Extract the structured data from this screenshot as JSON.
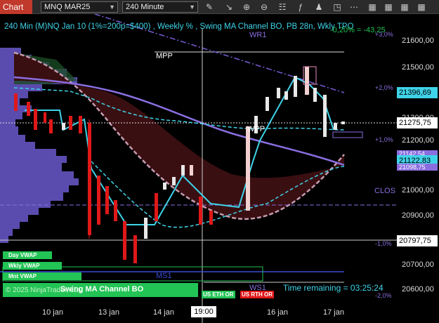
{
  "toolbar": {
    "tab_label": "Chart",
    "instrument": "MNQ MAR25",
    "interval": "240 Minute",
    "icons": [
      "draw-pencil-icon",
      "zoom-in-icon",
      "zoom-out-icon",
      "properties-icon",
      "indicators-icon",
      "strategy-icon",
      "screenshot-icon",
      "more-icon",
      "grid-icon-1",
      "grid-icon-2",
      "grid-icon-3",
      "grid-icon-4"
    ]
  },
  "chart": {
    "header": "240 Min (M)NQ Jan 10 (1%=200p=$400) , Weekly % , Swing MA Channel BO, PB 28n, Wkly TPO",
    "change_label": "-0,20% = -43,25",
    "labels": {
      "wr1": "WR1",
      "mpp": "MPP",
      "wpp": "WPP",
      "clos": "CLOS",
      "ms1": "MS1",
      "ws1": "WS1"
    },
    "pct_labels": [
      "+3,0%",
      "+2,0%",
      "+1,0%",
      "-1,0%",
      "-2,0%"
    ],
    "price_axis": [
      "21600,00",
      "21500,00",
      "21300,00",
      "21200,00",
      "21000,00",
      "20900,00",
      "20700,00",
      "20600,00"
    ],
    "price_tags": {
      "p1": "21396,69",
      "p2": "21275,75",
      "p3": "21122,83",
      "p4": "21098,75",
      "p5": "21142,54",
      "p6": "20797,75"
    },
    "date_axis": [
      "10 jan",
      "13 jan",
      "14 jan",
      "16 jan",
      "17 jan"
    ],
    "crosshair_date": "19:00",
    "vwap_buttons": [
      "Day VWAP",
      "Wkly VWAP",
      "Mnt VWAP"
    ],
    "footer_left": "© 2025 NinjaTrader, LLC",
    "footer_study": "Swing MA Channel BO",
    "badges": [
      "US ETH OR",
      "US RTH OR"
    ],
    "time_remaining": "Time remaining = 03:25:24",
    "colors": {
      "accent_red": "#c0392b",
      "cyan": "#3fd3e8",
      "purple": "#8a6ee0",
      "green": "#22c455",
      "channel": "#3a0f12"
    }
  }
}
